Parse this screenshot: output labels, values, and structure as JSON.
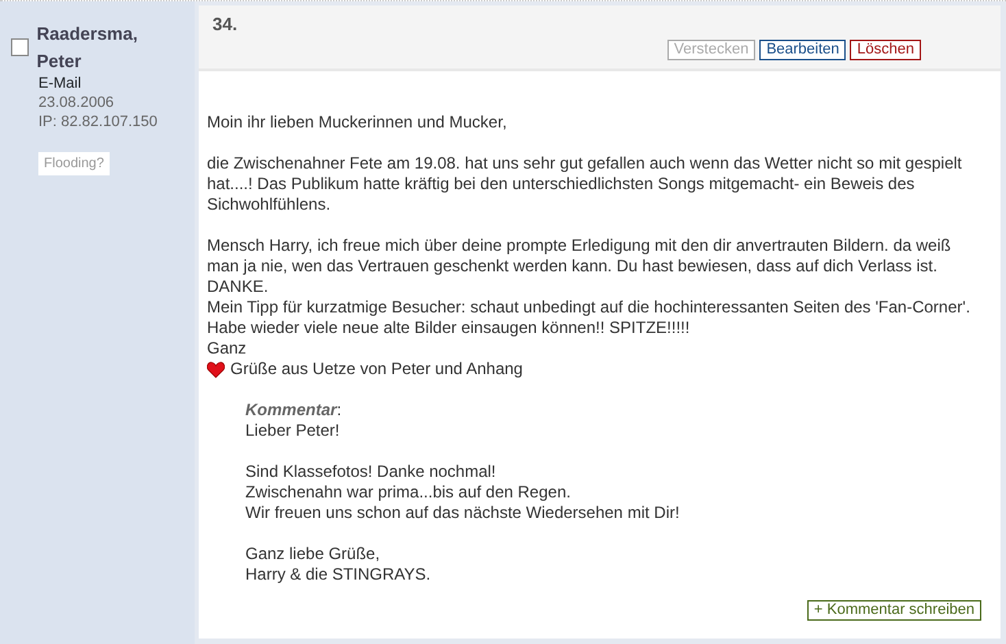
{
  "author": {
    "name": "Raadersma, Peter",
    "checked": false,
    "email": "E-Mail",
    "date": "23.08.2006",
    "ip": "IP: 82.82.107.150",
    "flag_button": "Flooding?"
  },
  "entry": {
    "number": "34.",
    "actions": [
      {
        "label": "Verstecken",
        "kind": "muted"
      },
      {
        "label": "Bearbeiten",
        "kind": "edit"
      },
      {
        "label": "Löschen",
        "kind": "delete"
      }
    ],
    "paragraphs": [
      [
        "Moin ihr lieben Muckerinnen und Mucker,"
      ],
      [
        "die Zwischenahner Fete am 19.08. hat uns sehr gut gefallen auch wenn das Wetter nicht so mit gespielt hat....! Das Publikum hatte kräftig bei den unterschiedlichsten Songs mitgemacht- ein Beweis des Sichwohlfühlens."
      ],
      [
        "Mensch Harry, ich freue mich über deine prompte Erledigung mit den dir anvertrauten Bildern. da weiß man ja nie, wen das Vertrauen geschenkt werden kann. Du hast bewiesen, dass auf dich Verlass ist. DANKE.",
        "Mein Tipp für kurzatmige Besucher: schaut unbedingt auf die hochinteressanten Seiten des 'Fan-Corner'.",
        "Habe wieder viele neue alte Bilder einsaugen können!! SPITZE!!!!!",
        "Ganz"
      ]
    ],
    "greeting": "Grüße aus Uetze von Peter und Anhang",
    "comment": {
      "label": "Kommentar",
      "label_suffix": ":",
      "paragraphs": [
        [
          "Lieber Peter!"
        ],
        [
          "Sind Klassefotos! Danke nochmal!",
          "Zwischenahn war prima...bis auf den Regen.",
          "Wir freuen uns schon auf das nächste Wiedersehen mit Dir!"
        ],
        [
          "Ganz liebe Grüße,",
          "Harry & die STINGRAYS."
        ]
      ]
    },
    "add_comment_button": "+ Kommentar schreiben"
  }
}
